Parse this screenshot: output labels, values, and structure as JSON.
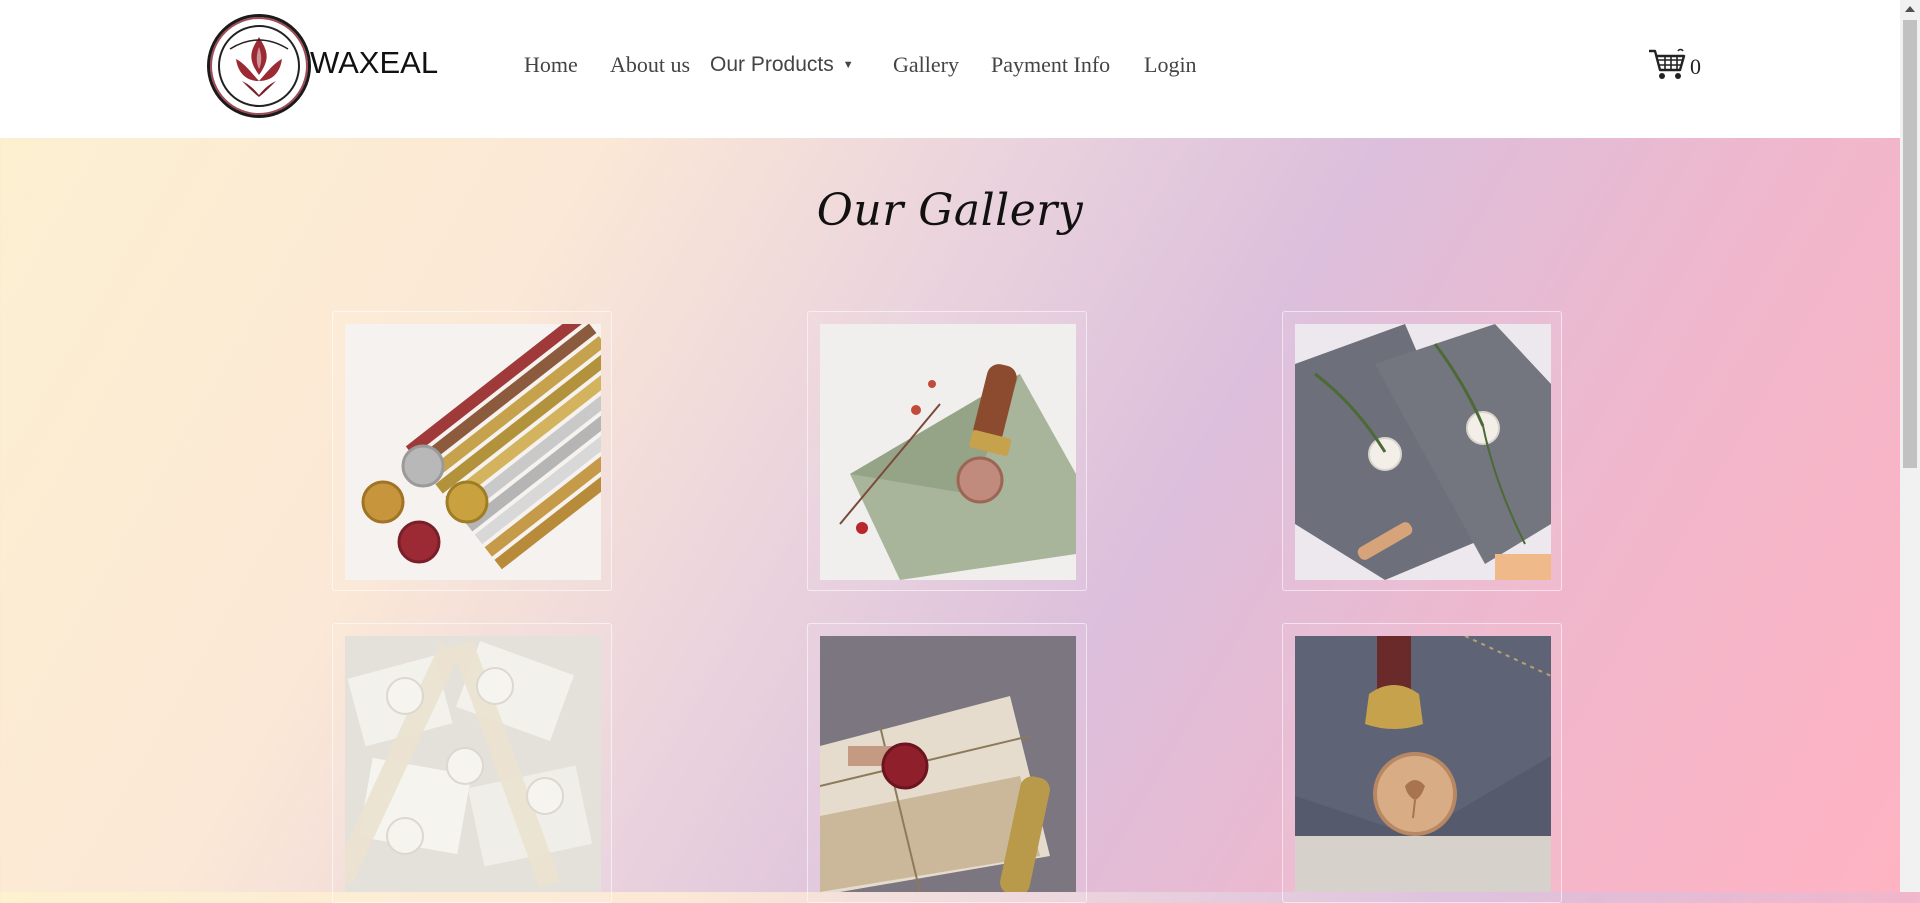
{
  "header": {
    "logo_text": "WAXEAL",
    "nav": [
      {
        "label": "Home"
      },
      {
        "label": "About us"
      },
      {
        "label": "Our Products",
        "caret": "▼"
      },
      {
        "label": "Gallery"
      },
      {
        "label": "Payment Info"
      },
      {
        "label": "Login"
      }
    ],
    "cart_count": "0",
    "cart_icon": "shopping-cart-icon"
  },
  "page": {
    "title": "Our Gallery"
  },
  "gallery": {
    "items": [
      {
        "name": "wax-sticks-and-seals"
      },
      {
        "name": "green-envelope-stamp"
      },
      {
        "name": "grey-envelopes-white-seals"
      },
      {
        "name": "white-seal-place-cards"
      },
      {
        "name": "gift-box-red-seal"
      },
      {
        "name": "rose-seal-navy-envelope"
      }
    ]
  },
  "colors": {
    "brand_red": "#9b2a34",
    "text": "#444444",
    "header_bg": "#ffffff"
  }
}
